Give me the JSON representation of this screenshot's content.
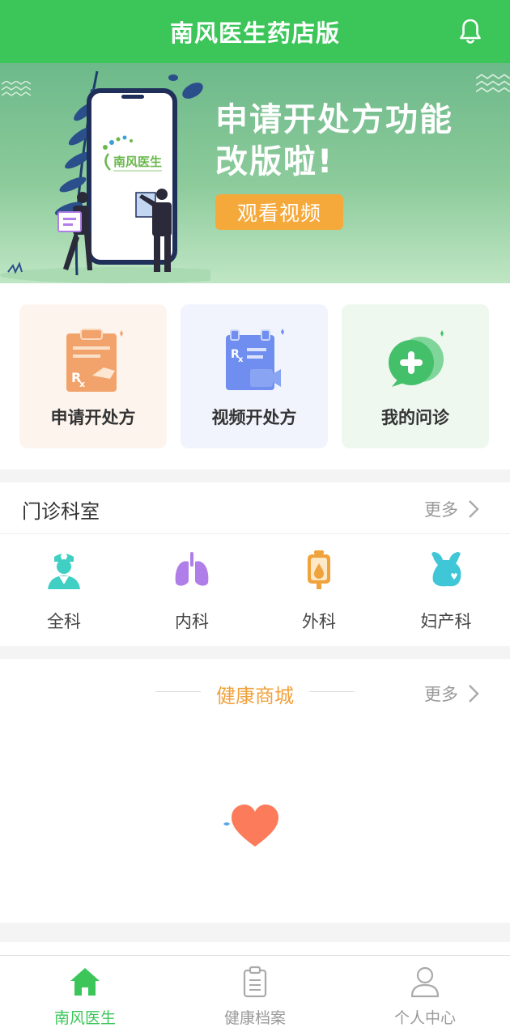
{
  "header": {
    "title": "南风医生药店版",
    "icon": "bell-icon"
  },
  "banner": {
    "logo_text": "南风医生",
    "headline_line1": "申请开处方功能",
    "headline_line2": "改版啦!",
    "button_label": "观看视频"
  },
  "quick_actions": [
    {
      "label": "申请开处方",
      "icon": "prescription-clipboard-icon",
      "bg": "#fdf4ee"
    },
    {
      "label": "视频开处方",
      "icon": "video-prescription-icon",
      "bg": "#f1f4fd"
    },
    {
      "label": "我的问诊",
      "icon": "chat-bubbles-icon",
      "bg": "#eef8ef"
    }
  ],
  "departments": {
    "title": "门诊科室",
    "more_label": "更多",
    "items": [
      {
        "label": "全科",
        "icon": "doctor-icon",
        "color": "#3fcfc3"
      },
      {
        "label": "内科",
        "icon": "lungs-icon",
        "color": "#b07ee8"
      },
      {
        "label": "外科",
        "icon": "iv-bag-icon",
        "color": "#f0a23c"
      },
      {
        "label": "妇产科",
        "icon": "uterus-icon",
        "color": "#3fc7d8"
      }
    ]
  },
  "mall": {
    "title": "健康商城",
    "more_label": "更多",
    "icon": "heart-icon"
  },
  "tabbar": {
    "items": [
      {
        "label": "南风医生",
        "icon": "home-icon",
        "active": true
      },
      {
        "label": "健康档案",
        "icon": "clipboard-icon",
        "active": false
      },
      {
        "label": "个人中心",
        "icon": "person-icon",
        "active": false
      }
    ]
  },
  "colors": {
    "brand": "#3cc65a",
    "accent": "#f0a23c"
  }
}
